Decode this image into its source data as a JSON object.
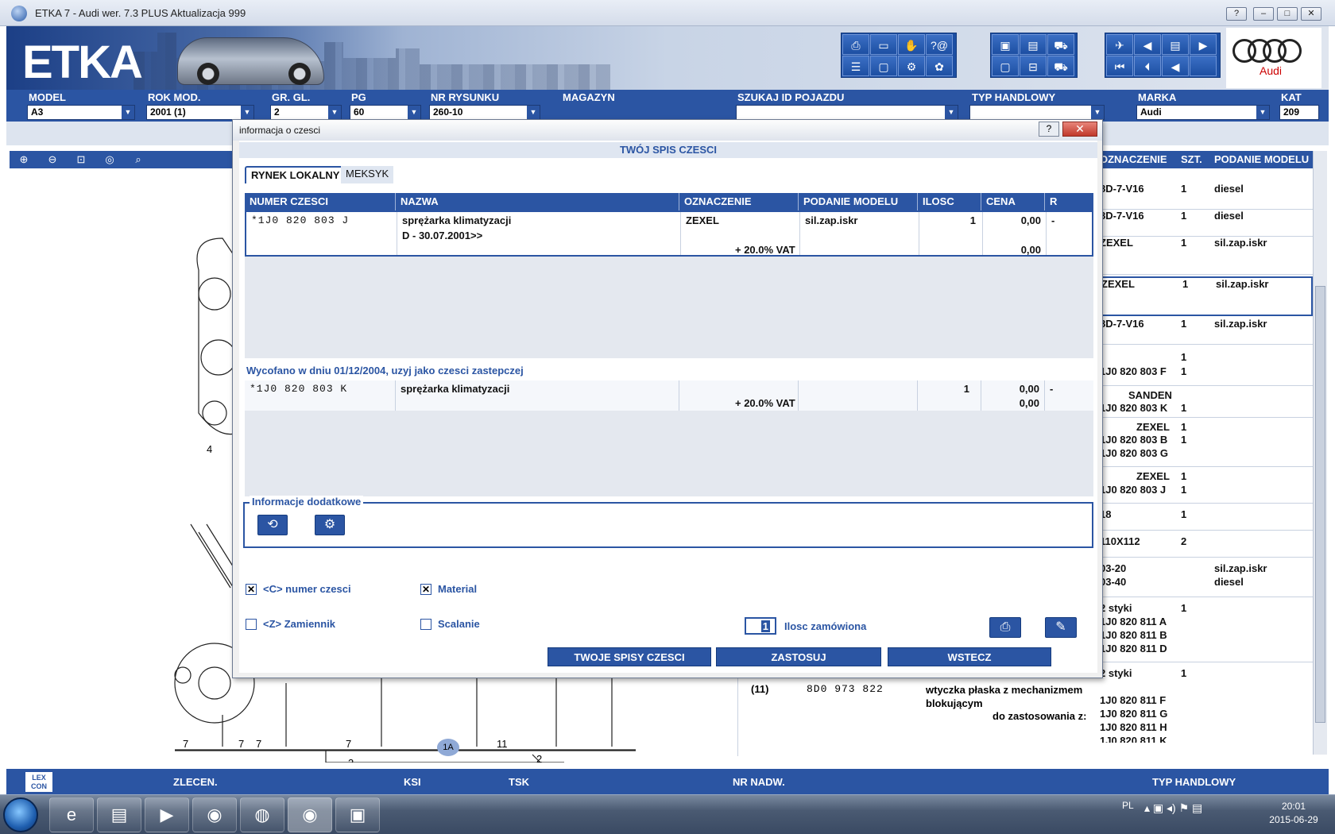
{
  "window": {
    "title": "ETKA 7 - Audi wer. 7.3 PLUS Aktualizacja 999",
    "help": "?",
    "minimize": "▭",
    "maximize": "□",
    "close": "✕"
  },
  "banner": {
    "logo": "ETKA",
    "brand": "Audi"
  },
  "fields": {
    "model": {
      "label": "MODEL",
      "value": "A3"
    },
    "year": {
      "label": "ROK MOD.",
      "value": "2001 (1)"
    },
    "gr": {
      "label": "GR. GL.",
      "value": "2"
    },
    "pg": {
      "label": "PG",
      "value": "60"
    },
    "drawing": {
      "label": "NR RYSUNKU",
      "value": "260-10"
    },
    "magazyn": {
      "label": "MAGAZYN"
    },
    "szukaj": {
      "label": "SZUKAJ ID POJAZDU"
    },
    "typ": {
      "label": "TYP HANDLOWY"
    },
    "marka": {
      "label": "MARKA",
      "value": "Audi"
    },
    "kat": {
      "label": "KAT",
      "value": "209"
    }
  },
  "right_table": {
    "headers": [
      "OZNACZENIE",
      "SZT.",
      "PODANIE MODELU"
    ],
    "rows": [
      {
        "oz": "8D-7-V16",
        "szt": "1",
        "model": "diesel"
      },
      {
        "oz": "8D-7-V16",
        "szt": "1",
        "model": "diesel"
      },
      {
        "oz": "ZEXEL",
        "szt": "1",
        "model": "sil.zap.iskr"
      },
      {
        "oz": "ZEXEL",
        "szt": "1",
        "model": "sil.zap.iskr"
      },
      {
        "oz": "8D-7-V16",
        "szt": "1",
        "model": "sil.zap.iskr"
      },
      {
        "oz": "1J0 820 803 F",
        "szt": "1",
        "model": ""
      },
      {
        "oz": "SANDEN",
        "oz2": "1J0 820 803 K",
        "szt": "1",
        "model": ""
      },
      {
        "oz": "ZEXEL",
        "oz2": "1J0 820 803 B",
        "oz3": "1J0 820 803 G",
        "szt": "1",
        "model": ""
      },
      {
        "oz": "ZEXEL",
        "oz2": "1J0 820 803 J",
        "szt": "1",
        "model": ""
      },
      {
        "oz": "18",
        "szt": "1",
        "model": ""
      },
      {
        "oz": "110X112",
        "szt": "2",
        "model": ""
      },
      {
        "oz": "03-20",
        "oz2": "03-40",
        "szt": "",
        "model": "sil.zap.iskr",
        "model2": "diesel"
      },
      {
        "oz": "2 styki",
        "oz2": "1J0 820 811 A",
        "oz3": "1J0 820 811 B",
        "oz4": "1J0 820 811 D",
        "szt": "1",
        "model": ""
      }
    ]
  },
  "bottom_table": {
    "pos": "(11)",
    "number": "8D0 973 822",
    "name": "wtyczka płaska z mechanizmem blokującym",
    "usage": "do zastosowania z:",
    "styki": "2 styki",
    "szt": "1",
    "list": [
      "1J0 820 811 F",
      "1J0 820 811 G",
      "1J0 820 811 H",
      "1J0 820 811 K"
    ]
  },
  "drawing_labels": [
    "4",
    "7",
    "7",
    "7",
    "7",
    "11",
    "3",
    "2",
    "1A"
  ],
  "bottombar": {
    "lex": "LEX CON",
    "items": [
      "ZLECEN.",
      "KSI",
      "TSK",
      "NR NADW.",
      "TYP HANDLOWY"
    ]
  },
  "dialog": {
    "title": "informacja o czesci",
    "help": "?",
    "close": "✕",
    "header": "TWÓJ SPIS CZESCI",
    "tabs": [
      "RYNEK LOKALNY",
      "MEKSYK"
    ],
    "columns": [
      "NUMER CZESCI",
      "NAZWA",
      "OZNACZENIE",
      "PODANIE MODELU",
      "ILOSC",
      "CENA",
      "R"
    ],
    "part": {
      "number": "*1J0 820 803 J",
      "name": "sprężarka klimatyzacji",
      "date": "D - 30.07.2001>>",
      "oznaczenie": "ZEXEL",
      "model": "sil.zap.iskr",
      "qty": "1",
      "price": "0,00",
      "r": "-",
      "vat": "+ 20.0% VAT",
      "price2": "0,00"
    },
    "withdrawn": "Wycofano w dniu 01/12/2004, uzyj jako czesci zastepczej",
    "replacement": {
      "number": "*1J0 820 803 K",
      "name": "sprężarka klimatyzacji",
      "qty": "1",
      "price": "0,00",
      "r": "-",
      "vat": "+ 20.0% VAT",
      "price2": "0,00"
    },
    "info_label": "Informacje dodatkowe",
    "checks": {
      "c_numer": {
        "label": "<C> numer czesci",
        "checked": true
      },
      "material": {
        "label": "Material",
        "checked": true
      },
      "z_zamiennik": {
        "label": "<Z> Zamiennik",
        "checked": false
      },
      "scalanie": {
        "label": "Scalanie",
        "checked": false
      }
    },
    "qty_value": "1",
    "qty_label": "Ilosc zamówiona",
    "buttons": {
      "lists": "TWOJE SPISY CZESCI",
      "apply": "ZASTOSUJ",
      "back": "WSTECZ"
    }
  },
  "taskbar": {
    "lang": "PL",
    "time": "20:01",
    "date": "2015-06-29"
  }
}
